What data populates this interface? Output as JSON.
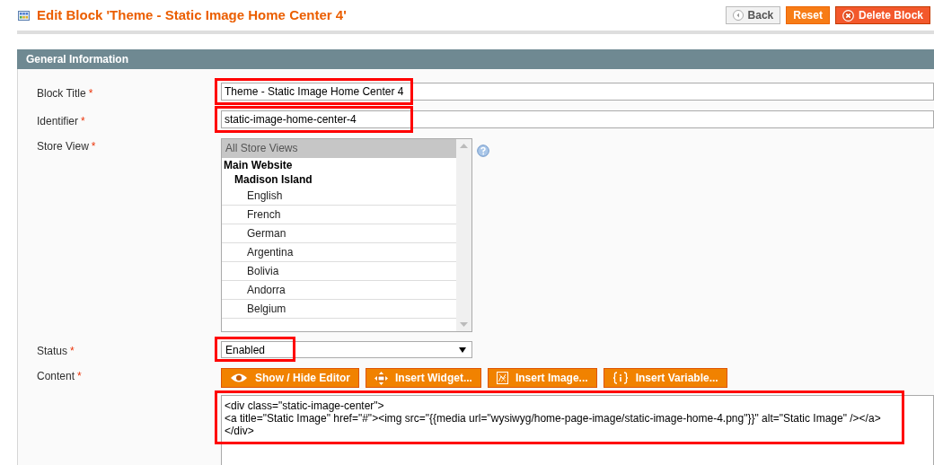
{
  "page_title": "Edit Block 'Theme - Static Image Home Center 4'",
  "header_buttons": [
    {
      "label": "Back",
      "kind": "default"
    },
    {
      "label": "Reset",
      "kind": "primary"
    },
    {
      "label": "Delete Block",
      "kind": "danger"
    }
  ],
  "section": {
    "title": "General Information"
  },
  "fields": [
    {
      "label": "Block Title",
      "required_mark": "*",
      "kind": "text",
      "value": "Theme - Static Image Home Center 4",
      "highlighted": true
    },
    {
      "label": "Identifier",
      "required_mark": "*",
      "kind": "text",
      "value": "static-image-home-center-4",
      "highlighted": true
    },
    {
      "label": "Store View",
      "required_mark": "*",
      "kind": "multiselect",
      "options": [
        {
          "label": "All Store Views",
          "kind": "option",
          "selected": true
        },
        {
          "label": "Main Website",
          "kind": "group",
          "children": [
            {
              "label": "Madison Island",
              "kind": "group",
              "children": [
                {
                  "label": "English",
                  "kind": "option",
                  "selected": false
                },
                {
                  "label": "French",
                  "kind": "option",
                  "selected": false
                },
                {
                  "label": "German",
                  "kind": "option",
                  "selected": false
                },
                {
                  "label": "Argentina",
                  "kind": "option",
                  "selected": false
                },
                {
                  "label": "Bolivia",
                  "kind": "option",
                  "selected": false
                },
                {
                  "label": "Andorra",
                  "kind": "option",
                  "selected": false
                },
                {
                  "label": "Belgium",
                  "kind": "option",
                  "selected": false
                }
              ]
            }
          ]
        }
      ]
    },
    {
      "label": "Status",
      "required_mark": "*",
      "kind": "select",
      "value": "Enabled",
      "highlighted": true
    },
    {
      "label": "Content",
      "required_mark": "*",
      "kind": "editor",
      "highlighted": true,
      "toolbar": [
        "Show / Hide Editor",
        "Insert Widget...",
        "Insert Image...",
        "Insert Variable..."
      ],
      "value": "<div class=\"static-image-center\">\n<a title=\"Static Image\" href=\"#\"><img src=\"{{media url=\"wysiwyg/home-page-image/static-image-home-4.png\"}}\" alt=\"Static Image\" /></a>\n</div>"
    }
  ]
}
